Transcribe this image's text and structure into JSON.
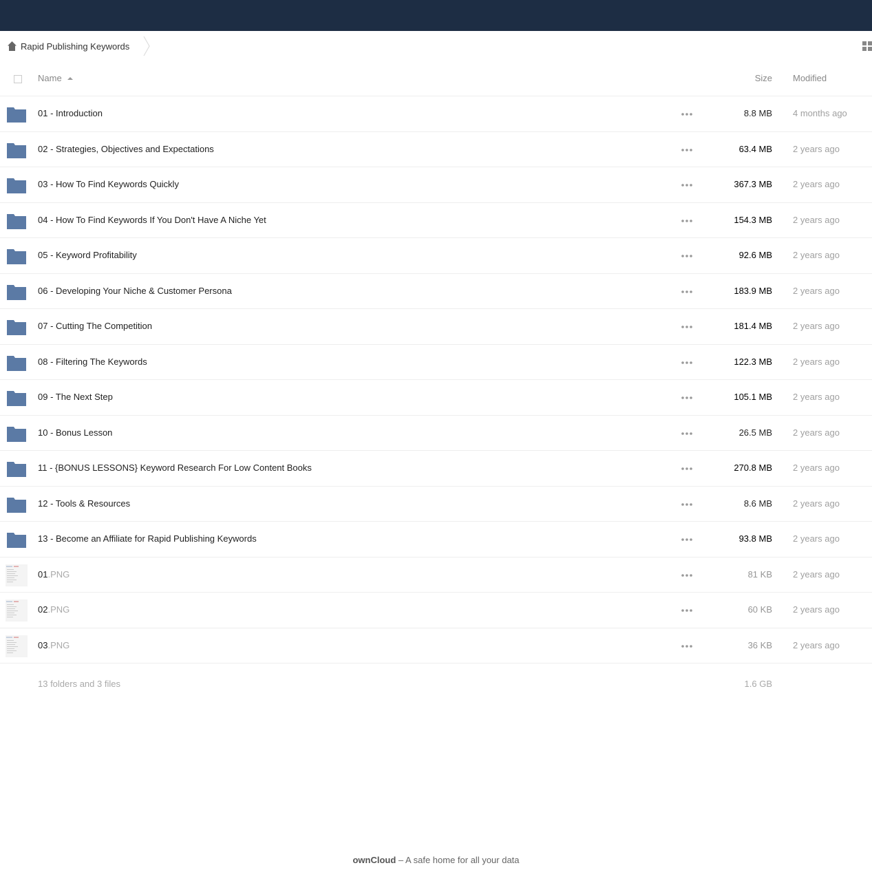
{
  "breadcrumb": {
    "home_label": "Rapid Publishing Keywords"
  },
  "header": {
    "name_label": "Name",
    "size_label": "Size",
    "modified_label": "Modified"
  },
  "colors": {
    "topbar": "#1d2d44",
    "folder": "#5b7aa5"
  },
  "files": [
    {
      "type": "folder",
      "name": "01 - Introduction",
      "size": "8.8 MB",
      "modified": "4 months ago"
    },
    {
      "type": "folder",
      "name": "02 - Strategies, Objectives and Expectations",
      "size": "63.4 MB",
      "modified": "2 years ago"
    },
    {
      "type": "folder",
      "name": "03 - How To Find Keywords Quickly",
      "size": "367.3 MB",
      "modified": "2 years ago"
    },
    {
      "type": "folder",
      "name": "04 - How To Find Keywords If You Don't Have A Niche Yet",
      "size": "154.3 MB",
      "modified": "2 years ago"
    },
    {
      "type": "folder",
      "name": "05 - Keyword Profitability",
      "size": "92.6 MB",
      "modified": "2 years ago"
    },
    {
      "type": "folder",
      "name": "06 - Developing Your Niche & Customer Persona",
      "size": "183.9 MB",
      "modified": "2 years ago"
    },
    {
      "type": "folder",
      "name": "07 - Cutting The Competition",
      "size": "181.4 MB",
      "modified": "2 years ago"
    },
    {
      "type": "folder",
      "name": "08 - Filtering The Keywords",
      "size": "122.3 MB",
      "modified": "2 years ago"
    },
    {
      "type": "folder",
      "name": "09 - The Next Step",
      "size": "105.1 MB",
      "modified": "2 years ago"
    },
    {
      "type": "folder",
      "name": "10 - Bonus Lesson",
      "size": "26.5 MB",
      "modified": "2 years ago"
    },
    {
      "type": "folder",
      "name": "11 - {BONUS LESSONS} Keyword Research For Low Content Books",
      "size": "270.8 MB",
      "modified": "2 years ago"
    },
    {
      "type": "folder",
      "name": "12 - Tools & Resources",
      "size": "8.6 MB",
      "modified": "2 years ago"
    },
    {
      "type": "folder",
      "name": "13 - Become an Affiliate for Rapid Publishing Keywords",
      "size": "93.8 MB",
      "modified": "2 years ago"
    },
    {
      "type": "file",
      "name": "01",
      "ext": ".PNG",
      "size": "81 KB",
      "modified": "2 years ago"
    },
    {
      "type": "file",
      "name": "02",
      "ext": ".PNG",
      "size": "60 KB",
      "modified": "2 years ago"
    },
    {
      "type": "file",
      "name": "03",
      "ext": ".PNG",
      "size": "36 KB",
      "modified": "2 years ago"
    }
  ],
  "summary": {
    "text": "13 folders and 3 files",
    "total_size": "1.6 GB"
  },
  "footer": {
    "brand": "ownCloud",
    "tagline": " – A safe home for all your data"
  }
}
